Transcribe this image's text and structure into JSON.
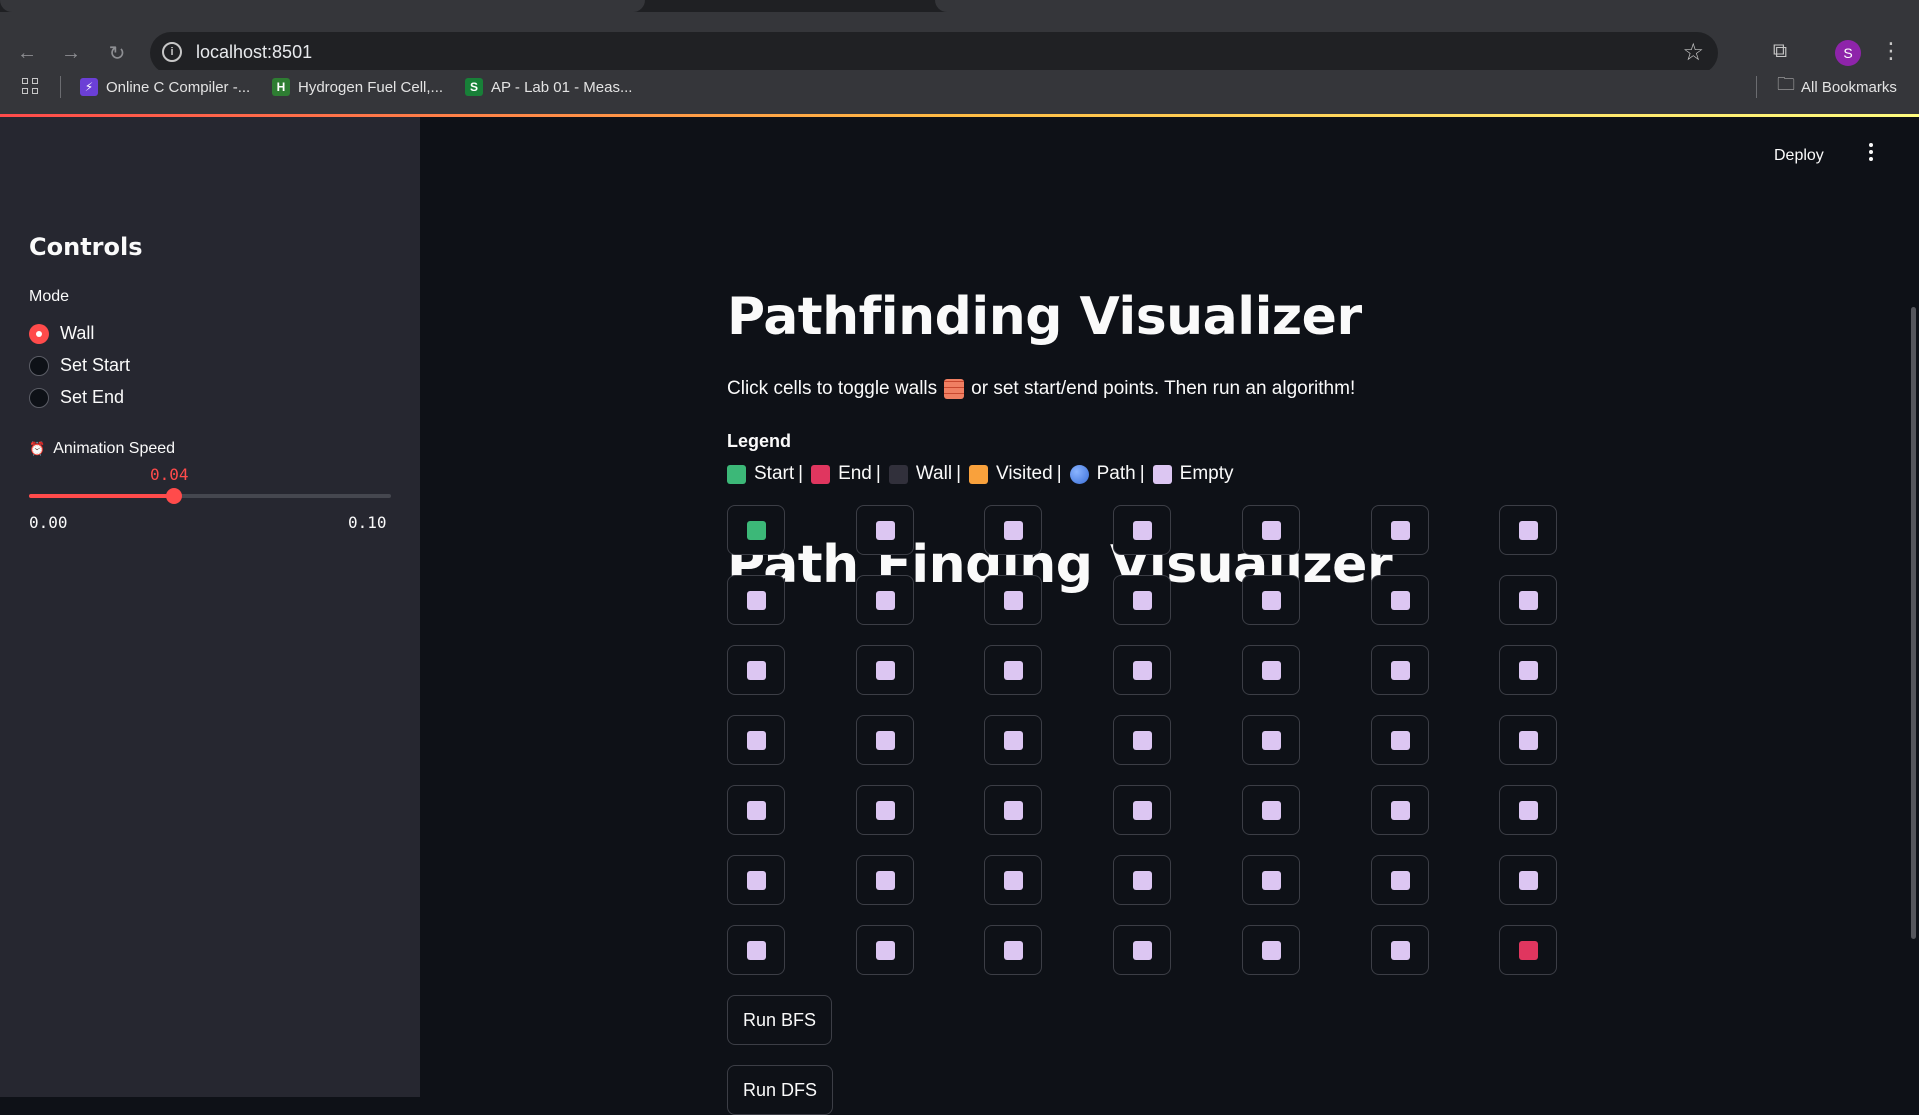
{
  "browser": {
    "url": "localhost:8501",
    "bookmarks": [
      {
        "label": "Online C Compiler -...",
        "icon": "bolt-icon",
        "color": "#6b3fd6"
      },
      {
        "label": "Hydrogen Fuel Cell,...",
        "icon": "hydrogen-icon",
        "color": "#2e7d32"
      },
      {
        "label": "AP - Lab 01 - Meas...",
        "icon": "s-icon",
        "color": "#188038"
      }
    ],
    "all_bookmarks": "All Bookmarks",
    "profile_initial": "S"
  },
  "header": {
    "deploy_label": "Deploy"
  },
  "sidebar": {
    "title": "Controls",
    "mode_label": "Mode",
    "modes": [
      "Wall",
      "Set Start",
      "Set End"
    ],
    "selected_mode": "Wall",
    "speed_label": "Animation Speed",
    "speed_value": "0.04",
    "speed_min": "0.00",
    "speed_max": "0.10",
    "speed_fraction": 0.4
  },
  "main": {
    "title": "Pathfinding Visualizer",
    "description_before": "Click cells to toggle walls",
    "description_after": "or set start/end points. Then run an algorithm!",
    "legend_title": "Legend",
    "legend": [
      {
        "label": "Start",
        "color": "#3cb878"
      },
      {
        "label": "End",
        "color": "#e0365f"
      },
      {
        "label": "Wall",
        "color": "#31303b"
      },
      {
        "label": "Visited",
        "color": "#f9a13c"
      },
      {
        "label": "Path",
        "color": "#4a84f0"
      },
      {
        "label": "Empty",
        "color": "#dcc6f2"
      }
    ],
    "subtitle": "Path Finding Visualizer",
    "grid": [
      [
        "start",
        "empty",
        "empty",
        "empty",
        "empty",
        "empty",
        "empty"
      ],
      [
        "empty",
        "empty",
        "empty",
        "empty",
        "empty",
        "empty",
        "empty"
      ],
      [
        "empty",
        "empty",
        "empty",
        "empty",
        "empty",
        "empty",
        "empty"
      ],
      [
        "empty",
        "empty",
        "empty",
        "empty",
        "empty",
        "empty",
        "empty"
      ],
      [
        "empty",
        "empty",
        "empty",
        "empty",
        "empty",
        "empty",
        "empty"
      ],
      [
        "empty",
        "empty",
        "empty",
        "empty",
        "empty",
        "empty",
        "empty"
      ],
      [
        "empty",
        "empty",
        "empty",
        "empty",
        "empty",
        "empty",
        "end"
      ]
    ],
    "buttons": [
      "Run BFS",
      "Run DFS"
    ]
  },
  "colors": {
    "accent": "#ff4b4b",
    "start": "#3cb878",
    "end": "#e0365f",
    "empty": "#dcc6f2"
  }
}
